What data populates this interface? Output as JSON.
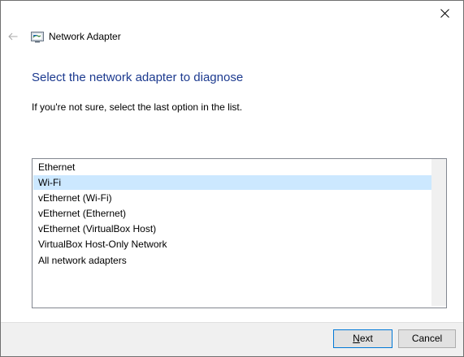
{
  "window": {
    "close_glyph": "✕"
  },
  "nav": {
    "back_glyph": "←",
    "title": "Network Adapter",
    "icon": "network-adapter-icon"
  },
  "content": {
    "heading": "Select the network adapter to diagnose",
    "instruction": "If you're not sure, select the last option in the list."
  },
  "adapters": {
    "selected_index": 1,
    "items": [
      "Ethernet",
      "Wi-Fi",
      "vEthernet (Wi-Fi)",
      "vEthernet (Ethernet)",
      "vEthernet (VirtualBox Host)",
      "VirtualBox Host-Only Network",
      "All network adapters"
    ]
  },
  "buttons": {
    "next": "Next",
    "cancel": "Cancel"
  },
  "colors": {
    "heading": "#1c3a8f",
    "selection": "#cce8ff",
    "footer_bg": "#f0f0f0",
    "default_button_border": "#0078d7"
  }
}
